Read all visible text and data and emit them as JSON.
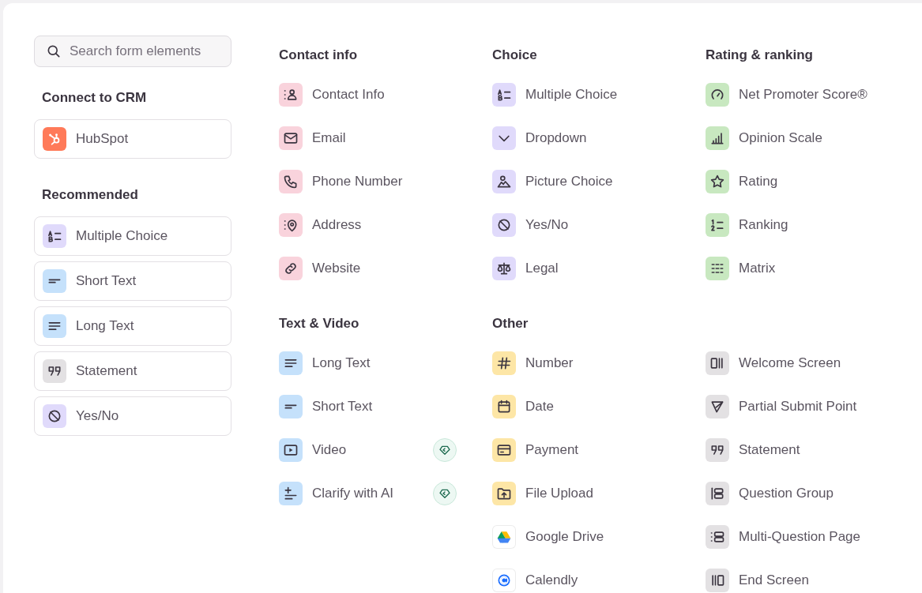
{
  "search": {
    "placeholder": "Search form elements"
  },
  "sidebar": {
    "sections": [
      {
        "title": "Connect to CRM",
        "items": [
          {
            "kind": "hubspot",
            "label": "HubSpot",
            "color": "#ff7a59"
          }
        ]
      },
      {
        "title": "Recommended",
        "items": [
          {
            "kind": "multiple-choice",
            "label": "Multiple Choice",
            "color": "#e0dafb"
          },
          {
            "kind": "short-text",
            "label": "Short Text",
            "color": "#c5e1fb"
          },
          {
            "kind": "long-text",
            "label": "Long Text",
            "color": "#c5e1fb"
          },
          {
            "kind": "statement",
            "label": "Statement",
            "color": "#e3e1e3"
          },
          {
            "kind": "yes-no",
            "label": "Yes/No",
            "color": "#e0dafb"
          }
        ]
      }
    ]
  },
  "columns": [
    {
      "sections": [
        {
          "title": "Contact info",
          "items": [
            {
              "kind": "contact-info",
              "label": "Contact Info",
              "color": "#f9d3dc"
            },
            {
              "kind": "email",
              "label": "Email",
              "color": "#f9d3dc"
            },
            {
              "kind": "phone",
              "label": "Phone Number",
              "color": "#f9d3dc"
            },
            {
              "kind": "address",
              "label": "Address",
              "color": "#f9d3dc"
            },
            {
              "kind": "website",
              "label": "Website",
              "color": "#f9d3dc"
            }
          ]
        },
        {
          "title": "Text & Video",
          "items": [
            {
              "kind": "long-text",
              "label": "Long Text",
              "color": "#c5e1fb"
            },
            {
              "kind": "short-text",
              "label": "Short Text",
              "color": "#c5e1fb"
            },
            {
              "kind": "video",
              "label": "Video",
              "color": "#c5e1fb",
              "premium": true
            },
            {
              "kind": "clarify",
              "label": "Clarify with AI",
              "color": "#c5e1fb",
              "premium": true
            }
          ]
        }
      ]
    },
    {
      "sections": [
        {
          "title": "Choice",
          "items": [
            {
              "kind": "multiple-choice",
              "label": "Multiple Choice",
              "color": "#e0dafb"
            },
            {
              "kind": "dropdown",
              "label": "Dropdown",
              "color": "#e0dafb"
            },
            {
              "kind": "picture",
              "label": "Picture Choice",
              "color": "#e0dafb"
            },
            {
              "kind": "yes-no",
              "label": "Yes/No",
              "color": "#e0dafb"
            },
            {
              "kind": "legal",
              "label": "Legal",
              "color": "#e0dafb"
            }
          ]
        },
        {
          "title": "Other",
          "items": [
            {
              "kind": "number",
              "label": "Number",
              "color": "#fde6a6"
            },
            {
              "kind": "date",
              "label": "Date",
              "color": "#fde6a6"
            },
            {
              "kind": "payment",
              "label": "Payment",
              "color": "#fde6a6"
            },
            {
              "kind": "file-upload",
              "label": "File Upload",
              "color": "#fde6a6"
            },
            {
              "kind": "google-drive",
              "label": "Google Drive",
              "color": "#ffffff"
            },
            {
              "kind": "calendly",
              "label": "Calendly",
              "color": "#ffffff"
            }
          ]
        }
      ]
    },
    {
      "sections": [
        {
          "title": "Rating & ranking",
          "items": [
            {
              "kind": "nps",
              "label": "Net Promoter Score®",
              "color": "#c8e8c0"
            },
            {
              "kind": "opinion-scale",
              "label": "Opinion Scale",
              "color": "#c8e8c0"
            },
            {
              "kind": "rating",
              "label": "Rating",
              "color": "#c8e8c0"
            },
            {
              "kind": "ranking",
              "label": "Ranking",
              "color": "#c8e8c0"
            },
            {
              "kind": "matrix",
              "label": "Matrix",
              "color": "#c8e8c0"
            }
          ]
        },
        {
          "items": [
            {
              "kind": "welcome",
              "label": "Welcome Screen",
              "color": "#e3e1e3"
            },
            {
              "kind": "partial-submit",
              "label": "Partial Submit Point",
              "color": "#e3e1e3"
            },
            {
              "kind": "statement",
              "label": "Statement",
              "color": "#e3e1e3"
            },
            {
              "kind": "question-group",
              "label": "Question Group",
              "color": "#e3e1e3"
            },
            {
              "kind": "multi-question",
              "label": "Multi-Question Page",
              "color": "#e3e1e3"
            },
            {
              "kind": "end-screen",
              "label": "End Screen",
              "color": "#e3e1e3"
            }
          ]
        }
      ]
    }
  ]
}
